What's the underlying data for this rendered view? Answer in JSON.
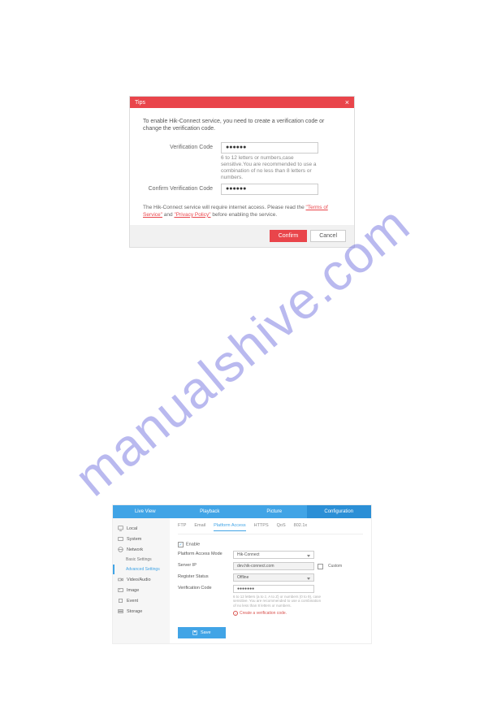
{
  "watermark": "manualshive.com",
  "dialog": {
    "title": "Tips",
    "close_glyph": "×",
    "intro": "To enable Hik-Connect service, you need to create a verification code or change the verification code.",
    "verification_label": "Verification Code",
    "verification_value": "●●●●●●",
    "hint": "6 to 12 letters or numbers,case sensitive.You are recommended to use a combination of no less than 8 letters or numbers.",
    "confirm_label": "Confirm Verification Code",
    "confirm_value": "●●●●●●",
    "legal_prefix": "The Hik-Connect service will require internet access. Please read the ",
    "terms_link": "\"Terms of Service\"",
    "legal_and": "and ",
    "privacy_link": "\"Privacy Policy\"",
    "legal_suffix": " before enabling the service.",
    "confirm_btn": "Confirm",
    "cancel_btn": "Cancel"
  },
  "panel": {
    "topnav": {
      "live": "Live View",
      "playback": "Playback",
      "picture": "Picture",
      "config": "Configuration"
    },
    "sidebar": {
      "local": "Local",
      "system": "System",
      "network": "Network",
      "basic": "Basic Settings",
      "advanced": "Advanced Settings",
      "video": "Video/Audio",
      "image": "Image",
      "event": "Event",
      "storage": "Storage"
    },
    "subtabs": {
      "ftp": "FTP",
      "email": "Email",
      "platform": "Platform Access",
      "https": "HTTPS",
      "qos": "QoS",
      "wifi": "802.1x"
    },
    "fields": {
      "enable_label": "Enable",
      "mode_label": "Platform Access Mode",
      "mode_value": "Hik-Connect",
      "server_label": "Server IP",
      "server_value": "dev.hik-connect.com",
      "custom_label": "Custom",
      "status_label": "Register Status",
      "status_value": "Offline",
      "vcode_label": "Verification Code",
      "vcode_value": "●●●●●●●",
      "vcode_hint": "6 to 12 letters (a to z, A to Z) or numbers (0 to 9), case sensitive. You are recommended to use a combination of no less than 8 letters or numbers.",
      "warning": "Create a verification code.",
      "save": "Save"
    }
  }
}
